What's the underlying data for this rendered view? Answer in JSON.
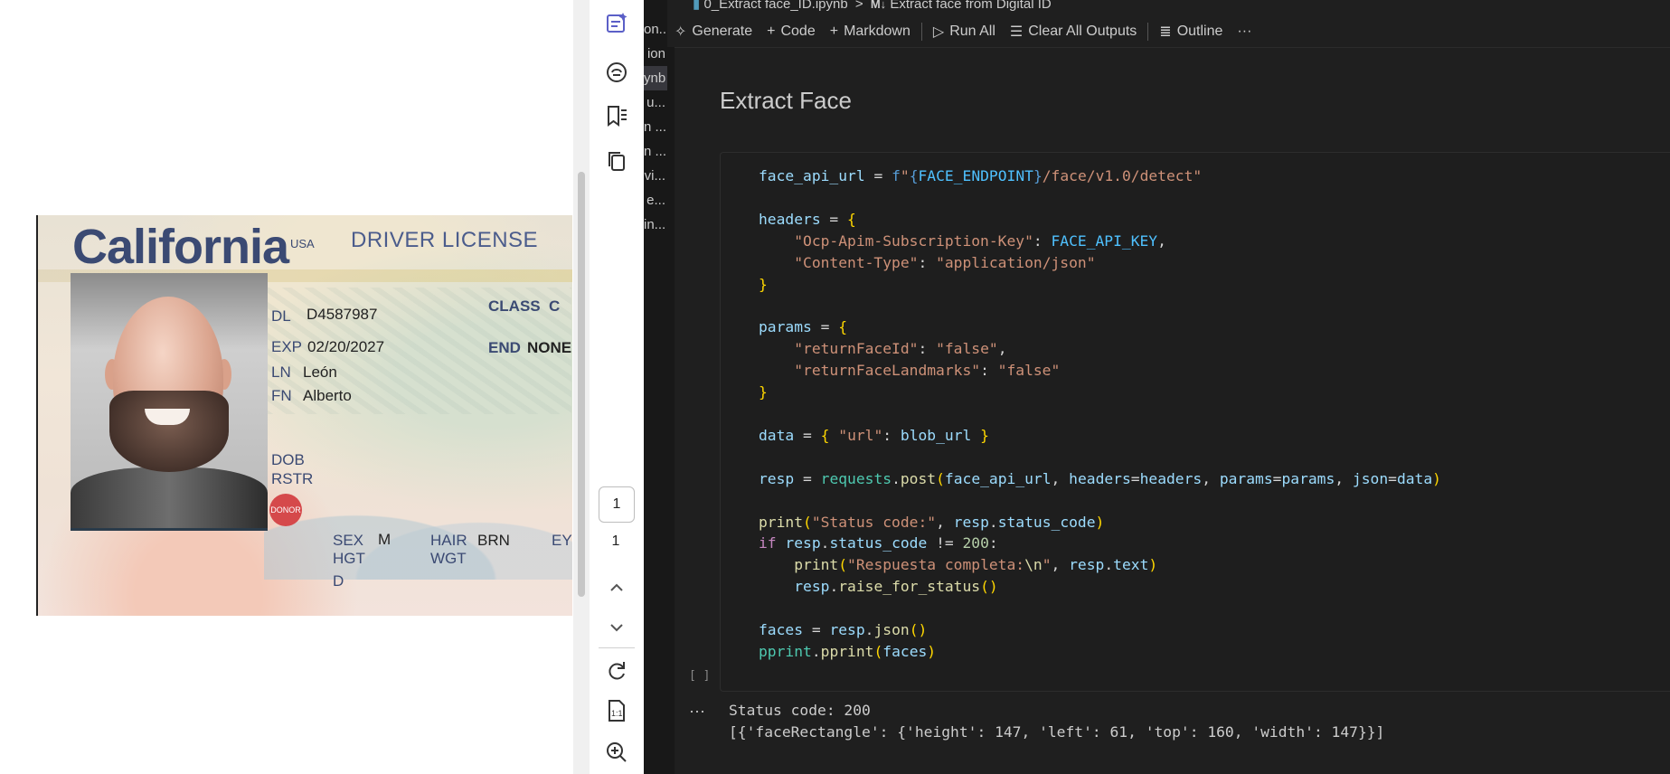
{
  "image_viewer": {
    "card": {
      "state": "California",
      "country": "USA",
      "title": "DRIVER LICENSE",
      "dl_label": "DL",
      "dl_value": "D4587987",
      "class_label": "CLASS",
      "class_value": "C",
      "exp_label": "EXP",
      "exp_value": "02/20/2027",
      "end_label": "END",
      "end_value": "NONE",
      "ln_label": "LN",
      "ln_value": "León",
      "fn_label": "FN",
      "fn_value": "Alberto",
      "dob_label": "DOB",
      "rstr_label": "RSTR",
      "donor": "DONOR",
      "sex_label": "SEX",
      "sex_value": "M",
      "hair_label": "HAIR",
      "hair_value": "BRN",
      "eyes_label": "EY",
      "hgt_label": "HGT",
      "wgt_label": "WGT",
      "d_label": "D"
    }
  },
  "side_strip": {
    "page_current": "1",
    "page_total": "1",
    "icons": [
      "sparkle-edit-icon",
      "copilot-icon",
      "bookmark-list-icon",
      "copy-icon",
      "chevron-up-icon",
      "chevron-down-icon",
      "refresh-icon",
      "actual-size-icon",
      "zoom-in-icon"
    ]
  },
  "explorer": {
    "items": [
      "on...",
      "ion",
      "ynb",
      "u...",
      "n ...",
      "n ...",
      "vi...",
      "e...",
      "in..."
    ]
  },
  "breadcrumb": {
    "file": "0_Extract face_ID.ipynb",
    "separator": ">",
    "section_prefix": "M↓",
    "section": "Extract face from Digital ID"
  },
  "toolbar": {
    "generate": "Generate",
    "code": "Code",
    "markdown": "Markdown",
    "run_all": "Run All",
    "clear_all_outputs": "Clear All Outputs",
    "outline": "Outline",
    "more": "···"
  },
  "notebook": {
    "markdown_heading": "Extract Face",
    "exec_count": "[ ]",
    "output_more": "···",
    "code_lines": [
      "face_api_url = f\"{FACE_ENDPOINT}/face/v1.0/detect\"",
      "",
      "headers = {",
      "    \"Ocp-Apim-Subscription-Key\": FACE_API_KEY,",
      "    \"Content-Type\": \"application/json\"",
      "}",
      "",
      "params = {",
      "    \"returnFaceId\": \"false\",",
      "    \"returnFaceLandmarks\": \"false\"",
      "}",
      "",
      "data = { \"url\": blob_url }",
      "",
      "resp = requests.post(face_api_url, headers=headers, params=params, json=data)",
      "",
      "print(\"Status code:\", resp.status_code)",
      "if resp.status_code != 200:",
      "    print(\"Respuesta completa:\\n\", resp.text)",
      "    resp.raise_for_status()",
      "",
      "faces = resp.json()",
      "pprint.pprint(faces)"
    ],
    "output_lines": [
      "Status code: 200",
      "[{'faceRectangle': {'height': 147, 'left': 61, 'top': 160, 'width': 147}}]"
    ]
  }
}
